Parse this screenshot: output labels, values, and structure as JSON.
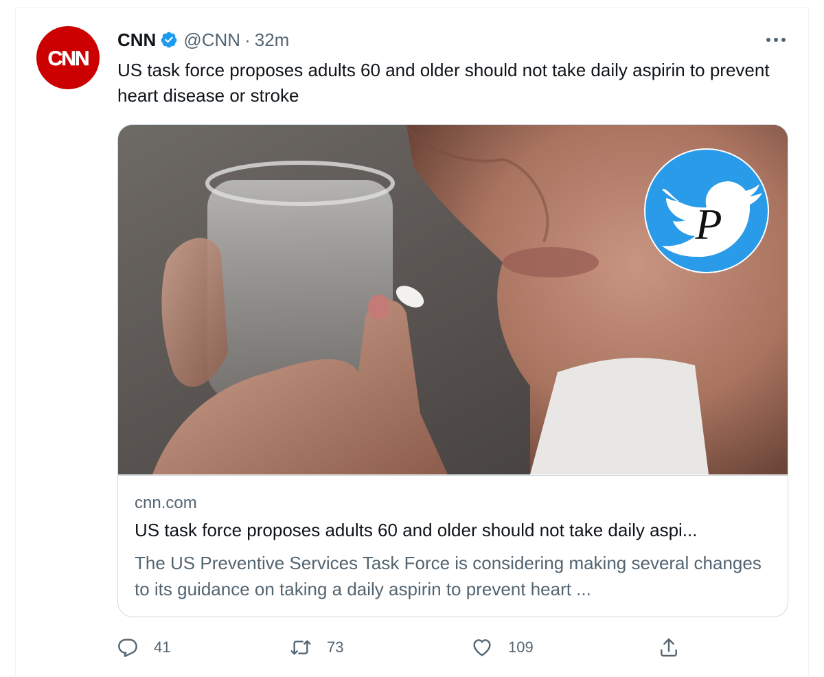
{
  "tweet": {
    "author_name": "CNN",
    "handle": "@CNN",
    "separator": "·",
    "time": "32m",
    "avatar_text": "CNN",
    "text": "US task force proposes adults 60 and older should not take daily aspirin to prevent heart disease or stroke"
  },
  "card": {
    "domain": "cnn.com",
    "title": "US task force proposes adults 60 and older should not take daily aspi...",
    "description": "The US Preventive Services Task Force is considering making several changes to its guidance on taking a daily aspirin to prevent heart ...",
    "watermark_letter": "P"
  },
  "actions": {
    "reply_count": "41",
    "retweet_count": "73",
    "like_count": "109"
  },
  "icons": {
    "verified": "verified-badge-icon",
    "more": "more-icon",
    "reply": "reply-icon",
    "retweet": "retweet-icon",
    "like": "like-icon",
    "share": "share-icon"
  },
  "colors": {
    "brand_red": "#cc0000",
    "verified_blue": "#1d9bf0",
    "text_primary": "#0f1419",
    "text_secondary": "#536471",
    "border": "#cfd9de"
  }
}
